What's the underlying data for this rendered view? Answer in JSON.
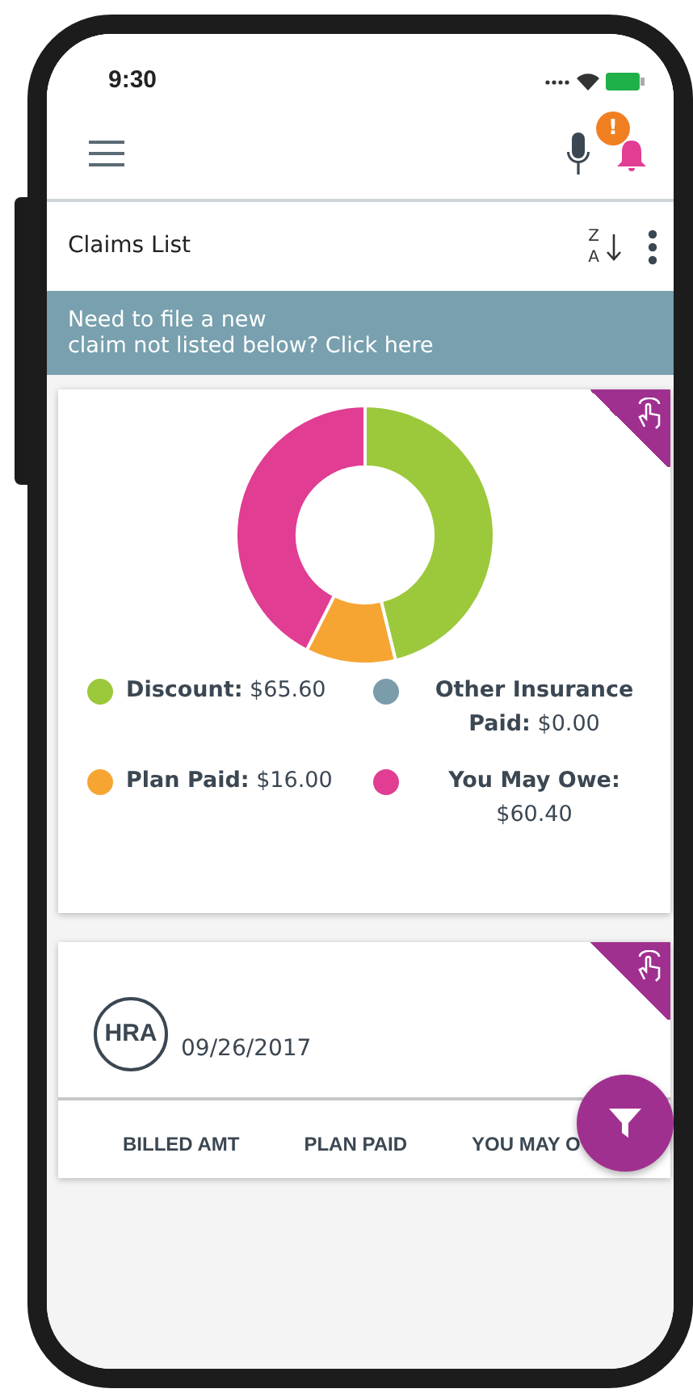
{
  "status_bar": {
    "time": "9:30"
  },
  "app_bar": {
    "notification_badge": "!"
  },
  "toolbar": {
    "title": "Claims List",
    "sort_letters": [
      "Z",
      "A"
    ]
  },
  "banner": {
    "text": "Need to file a new\nclaim not listed below? Click here"
  },
  "summary_card": {
    "chart_data": {
      "type": "donut",
      "values": [
        46.2,
        0,
        11.27,
        42.53
      ]
    },
    "legend": [
      {
        "text": "**Discount:** $65.60",
        "color": "#9cc83b"
      },
      {
        "text": "**Other Insurance Paid:** $0.00",
        "color": "#7a9cab"
      },
      {
        "text": "**Plan Paid:** $16.00",
        "color": "#f6a533"
      },
      {
        "text": "**You May Owe:** $60.40",
        "color": "#e03d93"
      }
    ]
  },
  "claim_card": {
    "plan": "HRA",
    "date": "09/26/2017",
    "columns": [
      "BILLED AMT",
      "PLAN PAID",
      "YOU MAY O"
    ]
  }
}
